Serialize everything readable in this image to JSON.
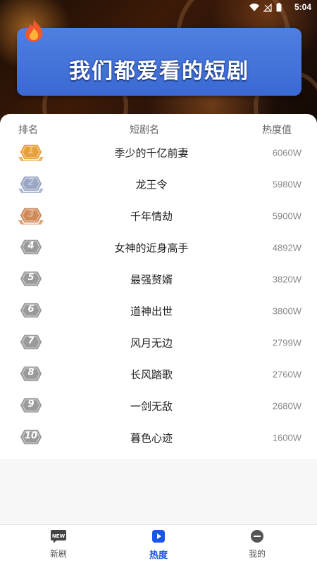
{
  "status": {
    "time": "5:04"
  },
  "banner": {
    "title": "我们都爱看的短剧"
  },
  "table": {
    "headers": {
      "rank": "排名",
      "name": "短剧名",
      "heat": "热度值"
    },
    "rows": [
      {
        "rank": "1",
        "name": "季少的千亿前妻",
        "heat": "6060W"
      },
      {
        "rank": "2",
        "name": "龙王令",
        "heat": "5980W"
      },
      {
        "rank": "3",
        "name": "千年情劫",
        "heat": "5900W"
      },
      {
        "rank": "4",
        "name": "女神的近身高手",
        "heat": "4892W"
      },
      {
        "rank": "5",
        "name": "最强赘婿",
        "heat": "3820W"
      },
      {
        "rank": "6",
        "name": "道神出世",
        "heat": "3800W"
      },
      {
        "rank": "7",
        "name": "风月无边",
        "heat": "2799W"
      },
      {
        "rank": "8",
        "name": "长风踏歌",
        "heat": "2760W"
      },
      {
        "rank": "9",
        "name": "一剑无敌",
        "heat": "2680W"
      },
      {
        "rank": "10",
        "name": "暮色心迹",
        "heat": "1600W"
      }
    ]
  },
  "tabs": [
    {
      "label": "新剧",
      "icon": "new-icon",
      "icon_text": "NEW"
    },
    {
      "label": "热度",
      "icon": "play-icon"
    },
    {
      "label": "我的",
      "icon": "profile-icon"
    }
  ],
  "colors": {
    "accent": "#1a56e8",
    "banner": "#3b69d3",
    "gold": "#e8a03c",
    "silver": "#9aa7c4",
    "bronze": "#d08a5a",
    "gray_badge": "#9a9a9a"
  }
}
